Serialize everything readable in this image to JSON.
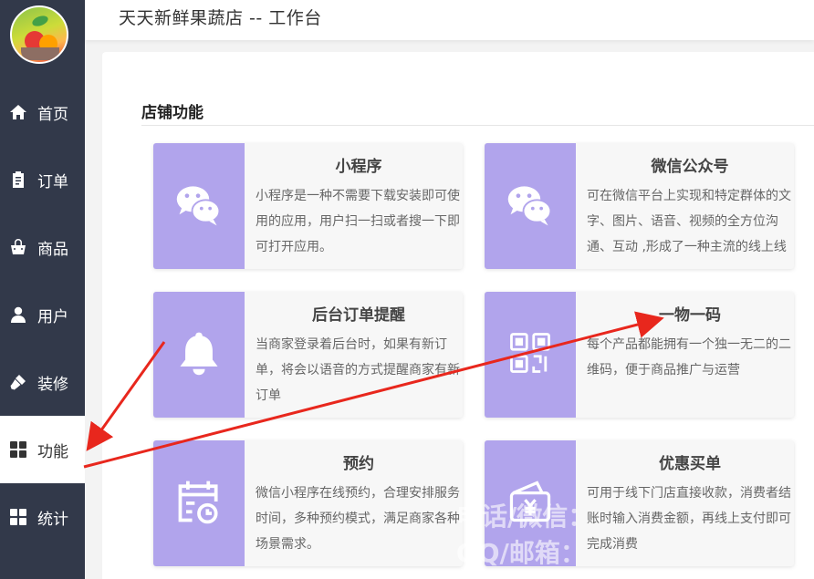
{
  "header": {
    "title": "天天新鲜果蔬店 -- 工作台"
  },
  "sidebar": {
    "items": [
      {
        "label": "首页",
        "icon": "home-icon"
      },
      {
        "label": "订单",
        "icon": "clipboard-icon"
      },
      {
        "label": "商品",
        "icon": "shopping-bag-icon"
      },
      {
        "label": "用户",
        "icon": "user-icon"
      },
      {
        "label": "装修",
        "icon": "paint-roller-icon"
      },
      {
        "label": "功能",
        "icon": "grid-icon",
        "active": true
      },
      {
        "label": "统计",
        "icon": "grid-stats-icon"
      }
    ]
  },
  "main": {
    "section_title": "店铺功能",
    "cards": [
      {
        "title": "小程序",
        "icon": "wechat-icon",
        "desc": "小程序是一种不需要下载安装即可使用的应用，用户扫一扫或者搜一下即可打开应用。"
      },
      {
        "title": "微信公众号",
        "icon": "wechat-icon",
        "desc": "可在微信平台上实现和特定群体的文字、图片、语音、视频的全方位沟通、互动 ,形成了一种主流的线上线下微信互动营销方式。"
      },
      {
        "title": "后台订单提醒",
        "icon": "bell-icon",
        "desc": "当商家登录着后台时，如果有新订单，将会以语音的方式提醒商家有新订单"
      },
      {
        "title": "一物一码",
        "icon": "qrcode-icon",
        "desc": "每个产品都能拥有一个独一无二的二维码，便于商品推广与运营"
      },
      {
        "title": "预约",
        "icon": "calendar-clock-icon",
        "desc": "微信小程序在线预约，合理安排服务时间，多种预约模式，满足商家各种场景需求。"
      },
      {
        "title": "优惠买单",
        "icon": "wallet-yen-icon",
        "desc": "可用于线下门店直接收款，消费者结账时输入消费金额，再线上支付即可完成消费"
      }
    ]
  },
  "watermark": {
    "line1": "电话/微信：",
    "line2": "QQ/邮箱："
  },
  "colors": {
    "sidebar_bg": "#32394a",
    "card_icon_bg": "#b1a4ec",
    "arrow": "#e8271d"
  }
}
